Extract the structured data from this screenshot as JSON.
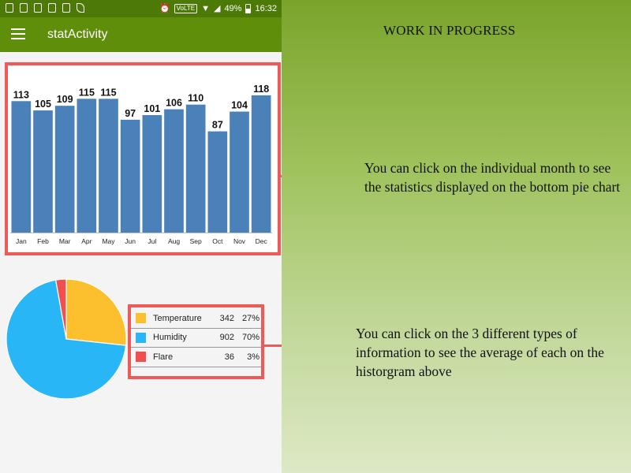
{
  "status_bar": {
    "battery": "49%",
    "time": "16:32",
    "volte": "VoLTE"
  },
  "app_bar": {
    "title": "statActivity"
  },
  "chart_data": [
    {
      "type": "bar",
      "categories": [
        "Jan",
        "Feb",
        "Mar",
        "Apr",
        "May",
        "Jun",
        "Jul",
        "Aug",
        "Sep",
        "Oct",
        "Nov",
        "Dec"
      ],
      "values": [
        113,
        105,
        109,
        115,
        115,
        97,
        101,
        106,
        110,
        87,
        104,
        118
      ],
      "ylim": [
        0,
        122
      ],
      "bar_color": "#4a81b8",
      "title": "",
      "xlabel": "",
      "ylabel": ""
    },
    {
      "type": "pie",
      "labels": [
        "Temperature",
        "Humidity",
        "Flare"
      ],
      "values": [
        342,
        902,
        36
      ],
      "percents": [
        "27%",
        "70%",
        "3%"
      ],
      "colors": [
        "#fcc02e",
        "#29b6f6",
        "#ef4f4f"
      ]
    }
  ],
  "legend": [
    {
      "label": "Temperature",
      "value": "342",
      "percent": "27%",
      "color": "#fcc02e"
    },
    {
      "label": "Humidity",
      "value": "902",
      "percent": "70%",
      "color": "#29b6f6"
    },
    {
      "label": "Flare",
      "value": "36",
      "percent": "3%",
      "color": "#ef4f4f"
    }
  ],
  "annotations": {
    "header": "WORK IN PROGRESS",
    "bar_note": "You can click on the individual month to see the statistics displayed on the bottom pie chart",
    "pie_note": "You can click on the 3 different types of information to see the average of each on the historgram above"
  },
  "colors": {
    "highlight": "#ee5a58",
    "status_bar": "#4d7a06",
    "app_bar": "#5f8f0a"
  }
}
